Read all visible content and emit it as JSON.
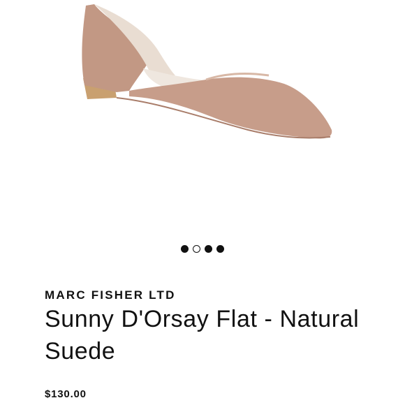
{
  "product": {
    "brand": "MARC FISHER LTD",
    "title": "Sunny D'Orsay Flat - Natural Suede",
    "price": "$130.00",
    "image": {
      "icon": "shoe-image",
      "color": "#c49a87"
    }
  },
  "carousel": {
    "dots": [
      {
        "state": "filled"
      },
      {
        "state": "empty"
      },
      {
        "state": "filled"
      },
      {
        "state": "filled"
      }
    ]
  }
}
